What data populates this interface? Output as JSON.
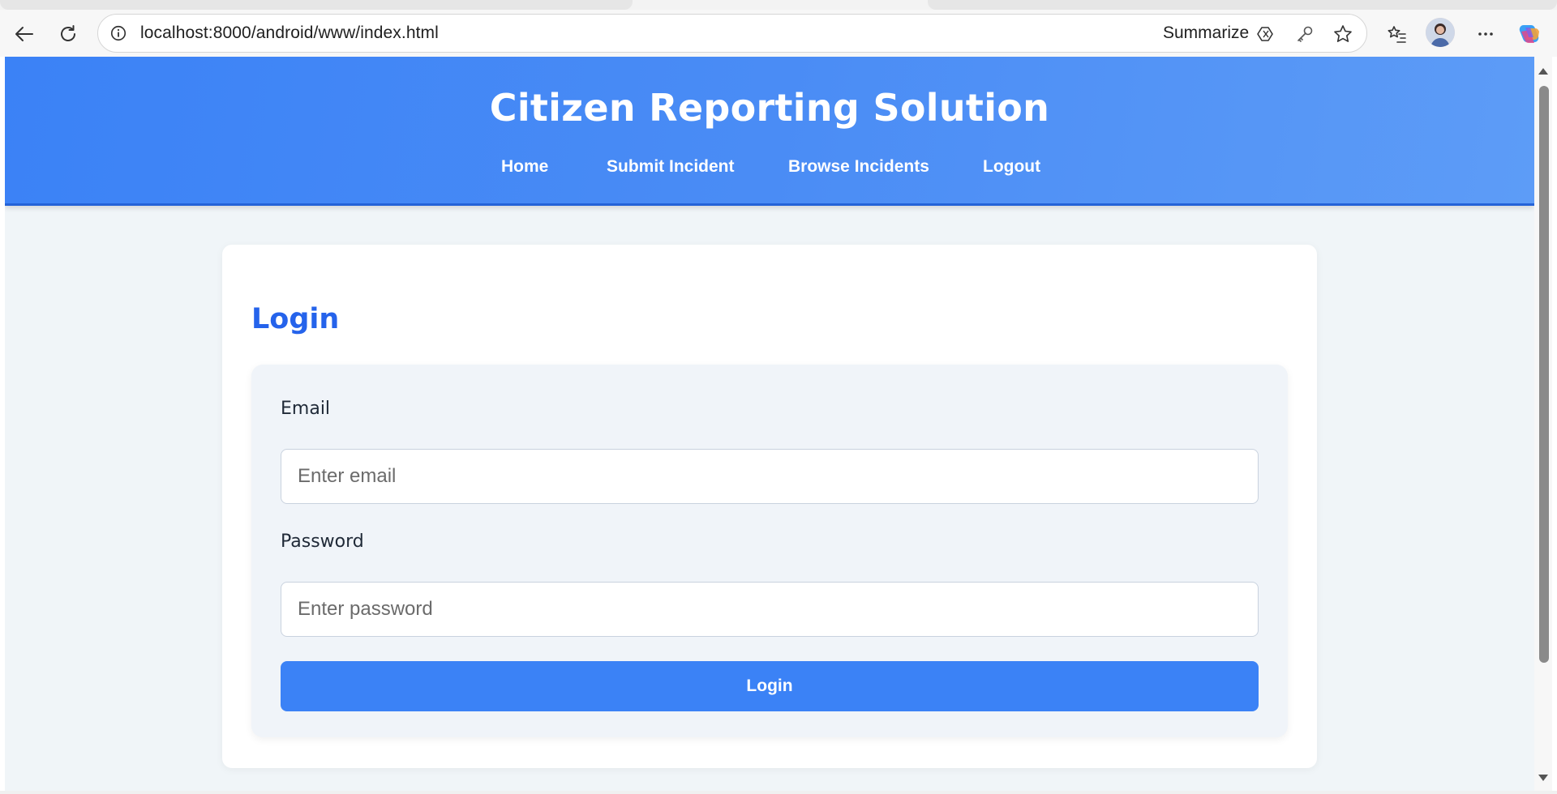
{
  "browser": {
    "url": "localhost:8000/android/www/index.html",
    "summarize_label": "Summarize",
    "icons": {
      "back": "back-arrow-icon",
      "refresh": "refresh-icon",
      "info": "info-icon",
      "copilot_page": "copilot-summarize-icon",
      "key": "key-icon",
      "star": "favorite-star-icon",
      "favorites": "favorites-list-icon",
      "profile": "profile-avatar",
      "more": "more-menu-icon",
      "copilot": "copilot-icon"
    }
  },
  "header": {
    "title": "Citizen Reporting Solution",
    "nav": [
      {
        "label": "Home"
      },
      {
        "label": "Submit Incident"
      },
      {
        "label": "Browse Incidents"
      },
      {
        "label": "Logout"
      }
    ]
  },
  "login": {
    "heading": "Login",
    "email_label": "Email",
    "email_value": "",
    "email_placeholder": "Enter email",
    "password_label": "Password",
    "password_value": "",
    "password_placeholder": "Enter password",
    "submit_label": "Login"
  },
  "colors": {
    "header_start": "#3b82f6",
    "header_end": "#5d9cf7",
    "accent": "#2563eb",
    "button": "#3b82f6",
    "page_bg": "#f0f5f8",
    "panel_bg": "#f0f4f9"
  }
}
